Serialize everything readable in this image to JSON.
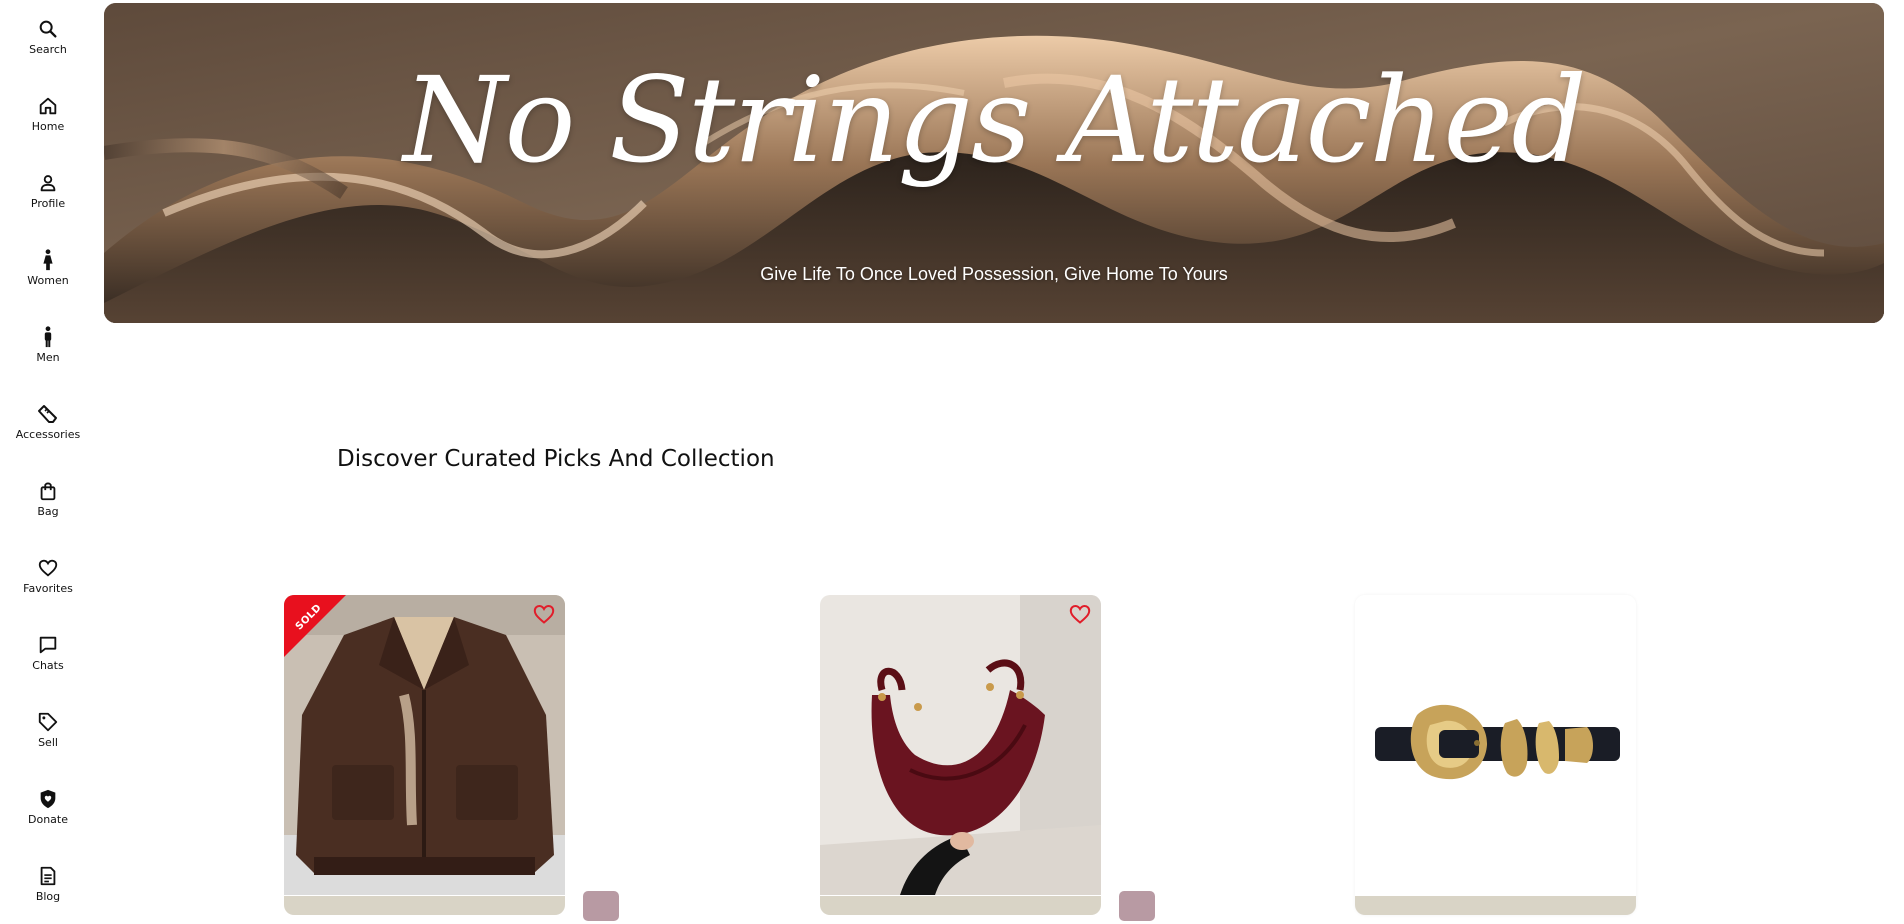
{
  "sidebar": {
    "items": [
      {
        "label": "Search",
        "icon": "search-icon"
      },
      {
        "label": "Home",
        "icon": "home-icon"
      },
      {
        "label": "Profile",
        "icon": "person-icon"
      },
      {
        "label": "Women",
        "icon": "woman-icon"
      },
      {
        "label": "Men",
        "icon": "man-icon"
      },
      {
        "label": "Accessories",
        "icon": "shoe-icon"
      },
      {
        "label": "Bag",
        "icon": "shopping-bag-icon"
      },
      {
        "label": "Favorites",
        "icon": "heart-icon"
      },
      {
        "label": "Chats",
        "icon": "chat-bubble-icon"
      },
      {
        "label": "Sell",
        "icon": "tag-icon"
      },
      {
        "label": "Donate",
        "icon": "shield-heart-icon"
      },
      {
        "label": "Blog",
        "icon": "document-icon"
      }
    ]
  },
  "hero": {
    "title": "No Strings Attached",
    "subtitle": "Give Life To Once Loved Possession, Give Home To Yours"
  },
  "section": {
    "heading": "Discover Curated Picks And Collection"
  },
  "products": [
    {
      "image": "leather-jacket",
      "badge": "SOLD",
      "favorite_icon": "heart-outline-icon"
    },
    {
      "image": "burgundy-handbag",
      "favorite_icon": "heart-outline-icon"
    },
    {
      "image": "gold-buckle-belt"
    }
  ],
  "colors": {
    "favorite": "#e11d2a",
    "sold_badge": "#e8101e",
    "mini_button": "#b89aa3",
    "card_strip": "#d9d4c6"
  }
}
